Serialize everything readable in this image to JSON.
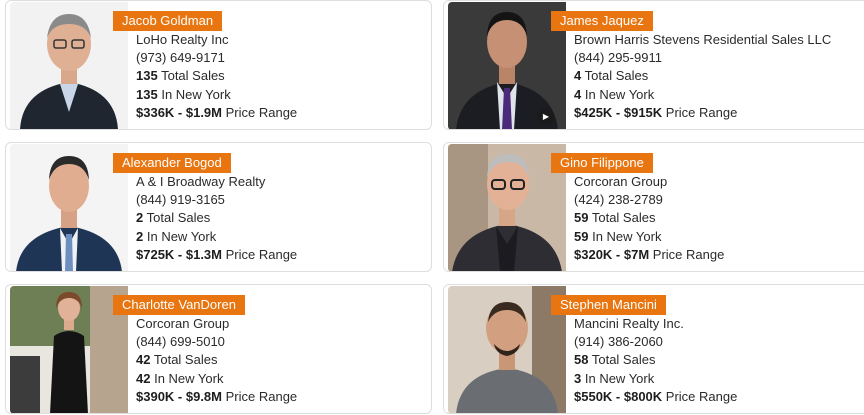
{
  "agents": [
    {
      "name": "Jacob Goldman",
      "company": "LoHo Realty Inc",
      "phone": "(973) 649-9171",
      "total_sales": "135",
      "total_sales_label": "Total Sales",
      "local_sales": "135",
      "local_sales_label": "In New York",
      "price_range": "$336K - $1.9M",
      "price_range_label": "Price Range",
      "photo_icon": "portrait-photo"
    },
    {
      "name": "James Jaquez",
      "company": "Brown Harris Stevens Residential Sales LLC",
      "phone": "(844) 295-9911",
      "total_sales": "4",
      "total_sales_label": "Total Sales",
      "local_sales": "4",
      "local_sales_label": "In New York",
      "price_range": "$425K - $915K",
      "price_range_label": "Price Range",
      "photo_icon": "portrait-photo",
      "video_icon": "play-icon"
    },
    {
      "name": "Alexander Bogod",
      "company": "A & I Broadway Realty",
      "phone": "(844) 919-3165",
      "total_sales": "2",
      "total_sales_label": "Total Sales",
      "local_sales": "2",
      "local_sales_label": "In New York",
      "price_range": "$725K - $1.3M",
      "price_range_label": "Price Range",
      "photo_icon": "portrait-photo"
    },
    {
      "name": "Gino Filippone",
      "company": "Corcoran Group",
      "phone": "(424) 238-2789",
      "total_sales": "59",
      "total_sales_label": "Total Sales",
      "local_sales": "59",
      "local_sales_label": "In New York",
      "price_range": "$320K - $7M",
      "price_range_label": "Price Range",
      "photo_icon": "portrait-photo"
    },
    {
      "name": "Charlotte VanDoren",
      "company": "Corcoran Group",
      "phone": "(844) 699-5010",
      "total_sales": "42",
      "total_sales_label": "Total Sales",
      "local_sales": "42",
      "local_sales_label": "In New York",
      "price_range": "$390K - $9.8M",
      "price_range_label": "Price Range",
      "photo_icon": "portrait-photo"
    },
    {
      "name": "Stephen Mancini",
      "company": "Mancini Realty Inc.",
      "phone": "(914) 386-2060",
      "total_sales": "58",
      "total_sales_label": "Total Sales",
      "local_sales": "3",
      "local_sales_label": "In New York",
      "price_range": "$550K - $800K",
      "price_range_label": "Price Range",
      "photo_icon": "portrait-photo"
    }
  ],
  "colors": {
    "badge": "#e8750f",
    "border": "#dedede",
    "text": "#2b2b2b"
  }
}
